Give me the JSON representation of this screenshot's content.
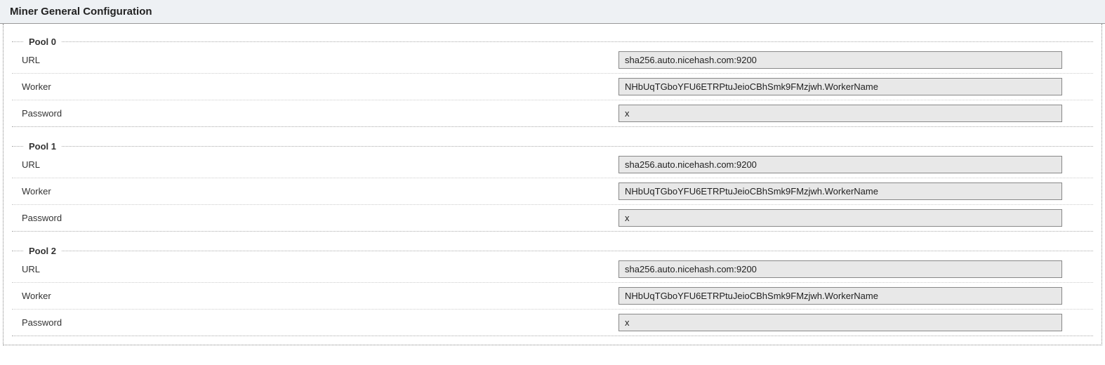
{
  "header": {
    "title": "Miner General Configuration"
  },
  "labels": {
    "url": "URL",
    "worker": "Worker",
    "password": "Password"
  },
  "pools": [
    {
      "legend": "Pool 0",
      "url": "sha256.auto.nicehash.com:9200",
      "worker": "NHbUqTGboYFU6ETRPtuJeioCBhSmk9FMzjwh.WorkerName",
      "password": "x"
    },
    {
      "legend": "Pool 1",
      "url": "sha256.auto.nicehash.com:9200",
      "worker": "NHbUqTGboYFU6ETRPtuJeioCBhSmk9FMzjwh.WorkerName",
      "password": "x"
    },
    {
      "legend": "Pool 2",
      "url": "sha256.auto.nicehash.com:9200",
      "worker": "NHbUqTGboYFU6ETRPtuJeioCBhSmk9FMzjwh.WorkerName",
      "password": "x"
    }
  ]
}
